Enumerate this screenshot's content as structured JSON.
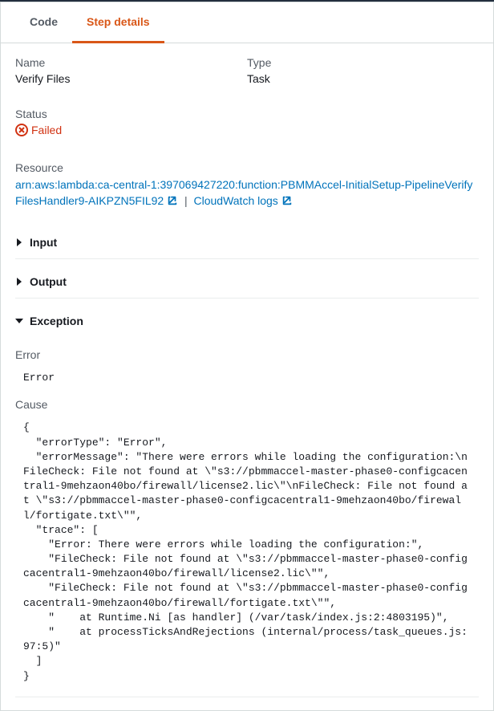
{
  "tabs": {
    "code": "Code",
    "step_details": "Step details"
  },
  "fields": {
    "name_label": "Name",
    "name_value": "Verify Files",
    "type_label": "Type",
    "type_value": "Task",
    "status_label": "Status",
    "status_value": "Failed",
    "resource_label": "Resource",
    "resource_arn": "arn:aws:lambda:ca-central-1:397069427220:function:PBMMAccel-InitialSetup-PipelineVerifyFilesHandler9-AIKPZN5FIL92",
    "cloudwatch_label": "CloudWatch logs"
  },
  "expanders": {
    "input": "Input",
    "output": "Output",
    "exception": "Exception"
  },
  "exception": {
    "error_label": "Error",
    "error_value": "Error",
    "cause_label": "Cause",
    "cause_value": "{\n  \"errorType\": \"Error\",\n  \"errorMessage\": \"There were errors while loading the configuration:\\nFileCheck: File not found at \\\"s3://pbmmaccel-master-phase0-configcacentral1-9mehzaon40bo/firewall/license2.lic\\\"\\nFileCheck: File not found at \\\"s3://pbmmaccel-master-phase0-configcacentral1-9mehzaon40bo/firewall/fortigate.txt\\\"\",\n  \"trace\": [\n    \"Error: There were errors while loading the configuration:\",\n    \"FileCheck: File not found at \\\"s3://pbmmaccel-master-phase0-configcacentral1-9mehzaon40bo/firewall/license2.lic\\\"\",\n    \"FileCheck: File not found at \\\"s3://pbmmaccel-master-phase0-configcacentral1-9mehzaon40bo/firewall/fortigate.txt\\\"\",\n    \"    at Runtime.Ni [as handler] (/var/task/index.js:2:4803195)\",\n    \"    at processTicksAndRejections (internal/process/task_queues.js:97:5)\"\n  ]\n}"
  }
}
